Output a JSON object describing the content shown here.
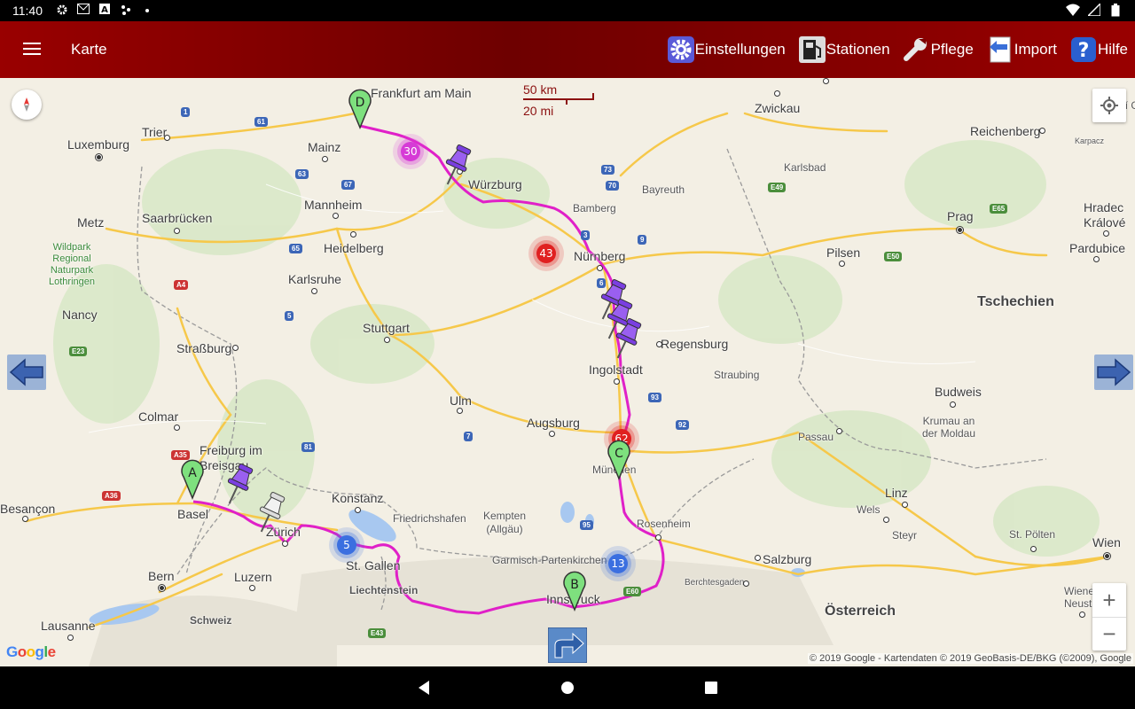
{
  "status_bar": {
    "time": "11:40",
    "left_icons": [
      "gear-icon",
      "mail-icon",
      "text-icon",
      "location-icon",
      "dot-icon"
    ],
    "right_icons": [
      "wifi-icon",
      "signal-icon",
      "battery-icon"
    ]
  },
  "app_bar": {
    "title": "Karte",
    "actions": [
      {
        "label": "Einstellungen",
        "icon": "gear-icon"
      },
      {
        "label": "Stationen",
        "icon": "fuel-station-icon"
      },
      {
        "label": "Pflege",
        "icon": "wrench-icon"
      },
      {
        "label": "Import",
        "icon": "import-icon"
      },
      {
        "label": "Hilfe",
        "icon": "help-icon"
      }
    ]
  },
  "map": {
    "scale": {
      "km": "50 km",
      "mi": "20 mi"
    },
    "cities": [
      "Frankfurt am Main",
      "Zwickau",
      "Trier",
      "Luxemburg",
      "Mainz",
      "Würzburg",
      "Bayreuth",
      "Reichenberg",
      "Karlsbad",
      "Saarbrücken",
      "Mannheim",
      "Bamberg",
      "Prag",
      "Hradec Králové",
      "Metz",
      "Heidelberg",
      "Nürnberg",
      "Pilsen",
      "Pardubice",
      "Karlsruhe",
      "Nancy",
      "Stuttgart",
      "Regensburg",
      "Tschechien",
      "Straßburg",
      "Ingolstadt",
      "Straubing",
      "Ulm",
      "Budweis",
      "Colmar",
      "Augsburg",
      "Krumau an der Moldau",
      "Passau",
      "Freiburg im Breisgau",
      "München",
      "Linz",
      "Besançon",
      "Basel",
      "Konstanz",
      "Friedrichshafen",
      "Kempten (Allgäu)",
      "Rosenheim",
      "Wels",
      "Steyr",
      "Zürich",
      "St. Gallen",
      "Salzburg",
      "St. Pölten",
      "Wien",
      "Bern",
      "Luzern",
      "Garmisch-Partenkirchen",
      "Liechtenstein",
      "Innsbruck",
      "Berchtesgaden",
      "Österreich",
      "Lausanne",
      "Schweiz",
      "Wiener Neustadt",
      "Jelení Gó",
      "Karpacz",
      "Wildpark Regional Naturpark Lothringen"
    ],
    "markers": [
      {
        "letter": "A"
      },
      {
        "letter": "B"
      },
      {
        "letter": "C"
      },
      {
        "letter": "D"
      }
    ],
    "clusters": [
      {
        "count": "30",
        "color": "#d63bd6"
      },
      {
        "count": "43",
        "color": "#e02020"
      },
      {
        "count": "62",
        "color": "#e02020"
      },
      {
        "count": "5",
        "color": "#3b6fe0"
      },
      {
        "count": "13",
        "color": "#3b6fe0"
      }
    ],
    "route_color": "#e020c8",
    "attribution_google": [
      "G",
      "o",
      "o",
      "g",
      "l",
      "e"
    ],
    "copyright": "© 2019 Google - Kartendaten © 2019 GeoBasis-DE/BKG (©2009), Google"
  },
  "colors": {
    "appbar": "#8b0000",
    "route": "#e020c8",
    "map_bg": "#f2efe6"
  }
}
